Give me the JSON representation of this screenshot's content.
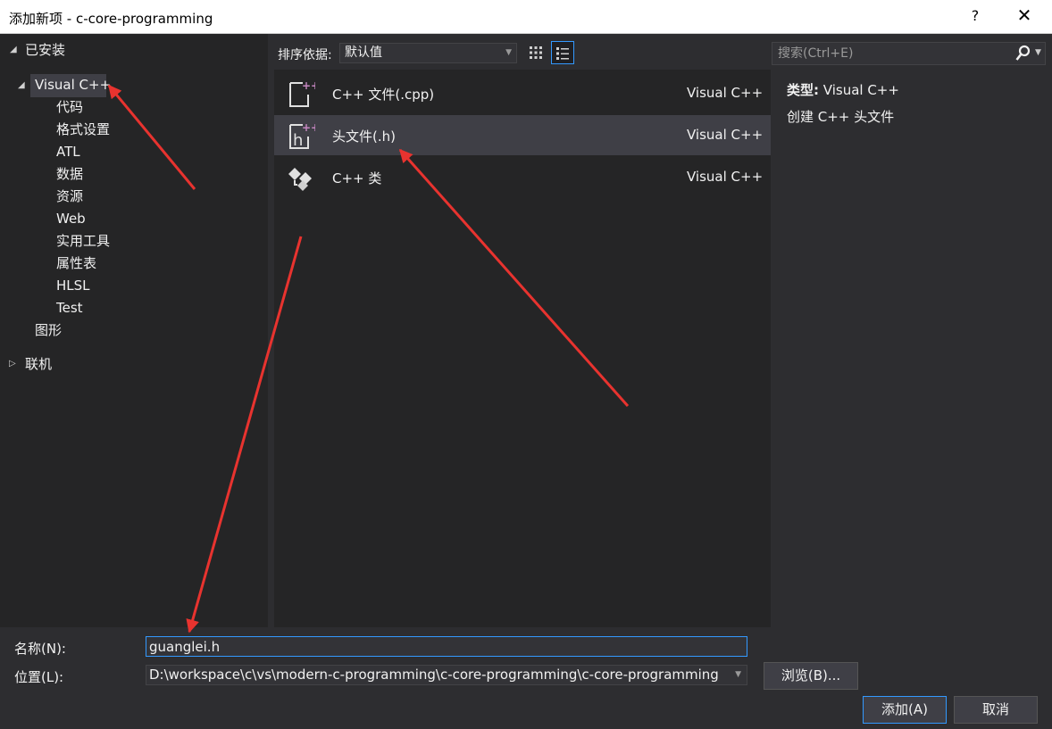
{
  "window": {
    "title": "添加新项 - c-core-programming",
    "help_label": "?",
    "close_label": "✕"
  },
  "tree": {
    "installed": "已安装",
    "visual_cpp": "Visual C++",
    "children": [
      "代码",
      "格式设置",
      "ATL",
      "数据",
      "资源",
      "Web",
      "实用工具",
      "属性表",
      "HLSL",
      "Test"
    ],
    "graphics": "图形",
    "online": "联机"
  },
  "toolbar": {
    "sort_label": "排序依据:",
    "sort_value": "默认值"
  },
  "templates": [
    {
      "name": "C++ 文件(.cpp)",
      "lang": "Visual C++",
      "icon": "cpp-file-icon"
    },
    {
      "name": "头文件(.h)",
      "lang": "Visual C++",
      "icon": "header-file-icon"
    },
    {
      "name": "C++ 类",
      "lang": "Visual C++",
      "icon": "cpp-class-icon"
    }
  ],
  "search": {
    "placeholder": "搜索(Ctrl+E)"
  },
  "details": {
    "type_label": "类型:",
    "type_value": "Visual C++",
    "description": "创建 C++ 头文件"
  },
  "form": {
    "name_label": "名称(N):",
    "name_value": "guanglei.h",
    "location_label": "位置(L):",
    "location_value": "D:\\workspace\\c\\vs\\modern-c-programming\\c-core-programming\\c-core-programming",
    "browse_label": "浏览(B)...",
    "add_label": "添加(A)",
    "cancel_label": "取消"
  },
  "colors": {
    "accent": "#3399ff",
    "annotation": "#e8332f",
    "icon_plus": "#c586c0"
  }
}
